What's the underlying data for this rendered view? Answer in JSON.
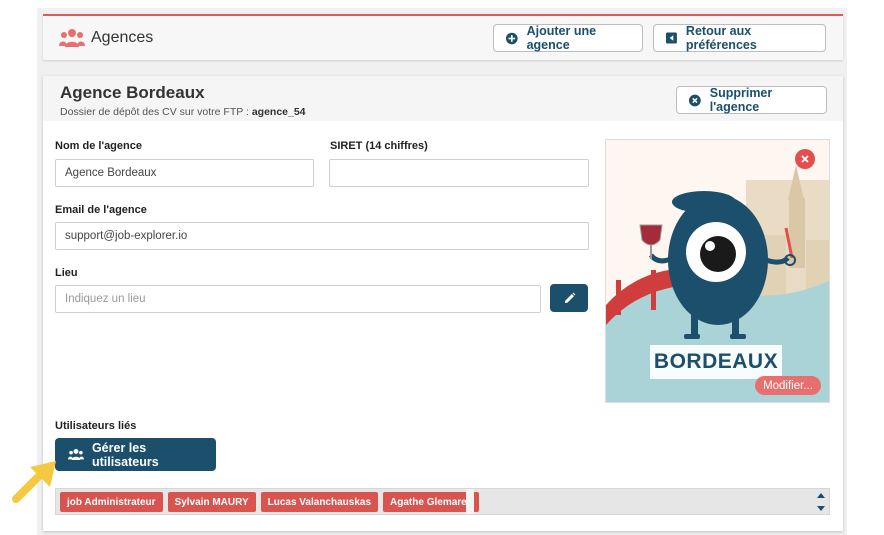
{
  "header": {
    "title": "Agences",
    "add_label": "Ajouter une agence",
    "back_label": "Retour aux préférences"
  },
  "agency": {
    "title": "Agence Bordeaux",
    "ftp_prefix": "Dossier de dépôt des CV sur votre FTP :",
    "ftp_folder": "agence_54",
    "delete_label": "Supprimer l'agence"
  },
  "form": {
    "name_label": "Nom de l'agence",
    "name_value": "Agence Bordeaux",
    "siret_label": "SIRET (14 chiffres)",
    "siret_value": "",
    "email_label": "Email de l'agence",
    "email_value": "support@job-explorer.io",
    "place_label": "Lieu",
    "place_placeholder": "Indiquez un lieu"
  },
  "illustration": {
    "city": "BORDEAUX",
    "modify_label": "Modifier..."
  },
  "users": {
    "label": "Utilisateurs liés",
    "manage_label": "Gérer les utilisateurs",
    "tags": [
      "job Administrateur",
      "Sylvain MAURY",
      "Lucas Valanchauskas",
      "Agathe Glemarec"
    ]
  },
  "colors": {
    "brand": "#1b4f6b",
    "accent": "#e05a5a",
    "tag": "#d9534f",
    "pointer": "#f5c842"
  },
  "icons": {
    "header": "users-icon",
    "add": "plus-circle-icon",
    "back": "back-square-icon",
    "delete": "times-circle-icon",
    "edit": "pencil-icon",
    "manage": "users-icon",
    "close": "close-icon"
  }
}
